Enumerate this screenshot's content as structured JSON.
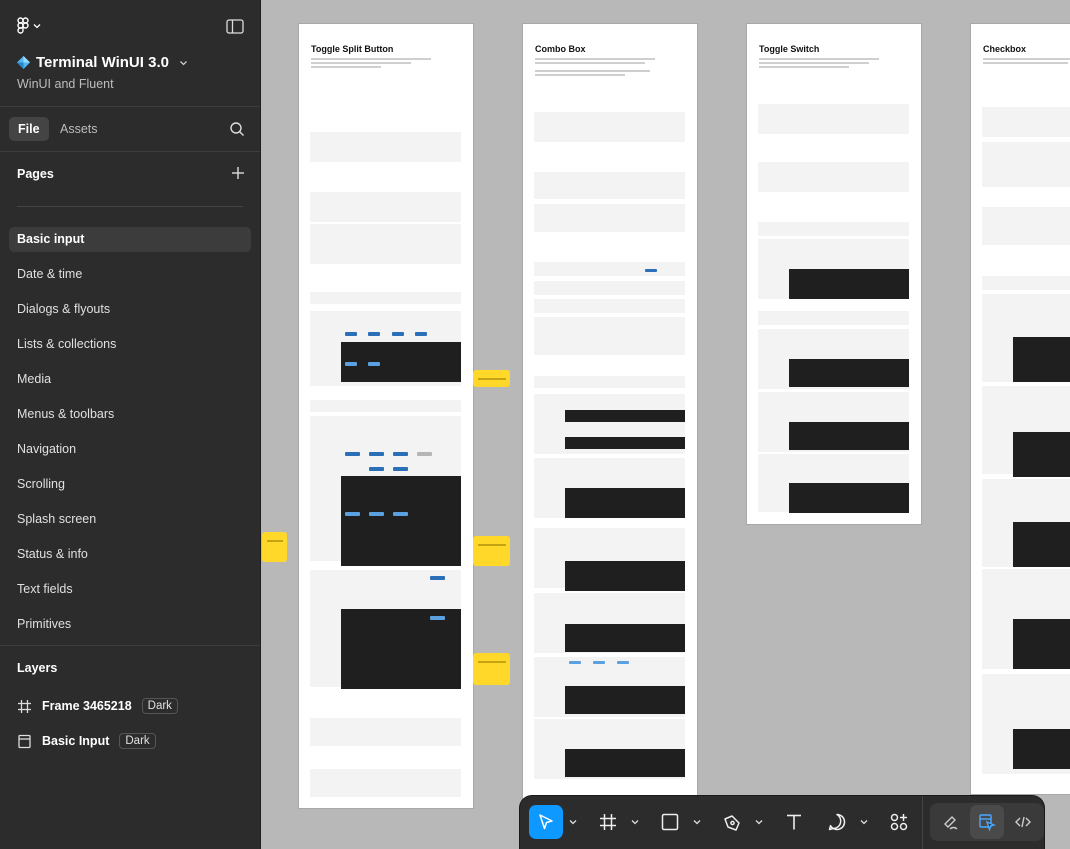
{
  "project": {
    "title": "Terminal WinUI 3.0",
    "subtitle": "WinUI and Fluent"
  },
  "tabs": {
    "file": "File",
    "assets": "Assets"
  },
  "pages": {
    "label": "Pages",
    "items": [
      "Basic input",
      "Date & time",
      "Dialogs & flyouts",
      "Lists & collections",
      "Media",
      "Menus & toolbars",
      "Navigation",
      "Scrolling",
      "Splash screen",
      "Status & info",
      "Text fields",
      "Primitives"
    ],
    "active_index": 0
  },
  "layers": {
    "label": "Layers",
    "items": [
      {
        "name": "Frame 3465218",
        "badge": "Dark",
        "icon": "frame-icon"
      },
      {
        "name": "Basic Input",
        "badge": "Dark",
        "icon": "page-icon"
      }
    ]
  },
  "frames": [
    {
      "title": "Toggle Split Button"
    },
    {
      "title": "Combo Box"
    },
    {
      "title": "Toggle Switch"
    },
    {
      "title": "Checkbox"
    }
  ],
  "toolbar": {
    "tools": [
      "move-tool",
      "frame-tool",
      "rectangle-tool",
      "pen-tool",
      "text-tool",
      "comment-tool",
      "actions-tool"
    ],
    "active_tool": "move-tool",
    "modes": [
      "draw-mode",
      "design-mode",
      "dev-mode"
    ],
    "active_mode": "design-mode"
  },
  "colors": {
    "accent": "#0d99ff",
    "sidebar": "#2c2c2c",
    "canvas": "#b8b8b8",
    "sticky": "#ffd829",
    "component_blue": "#2b6fb8"
  }
}
